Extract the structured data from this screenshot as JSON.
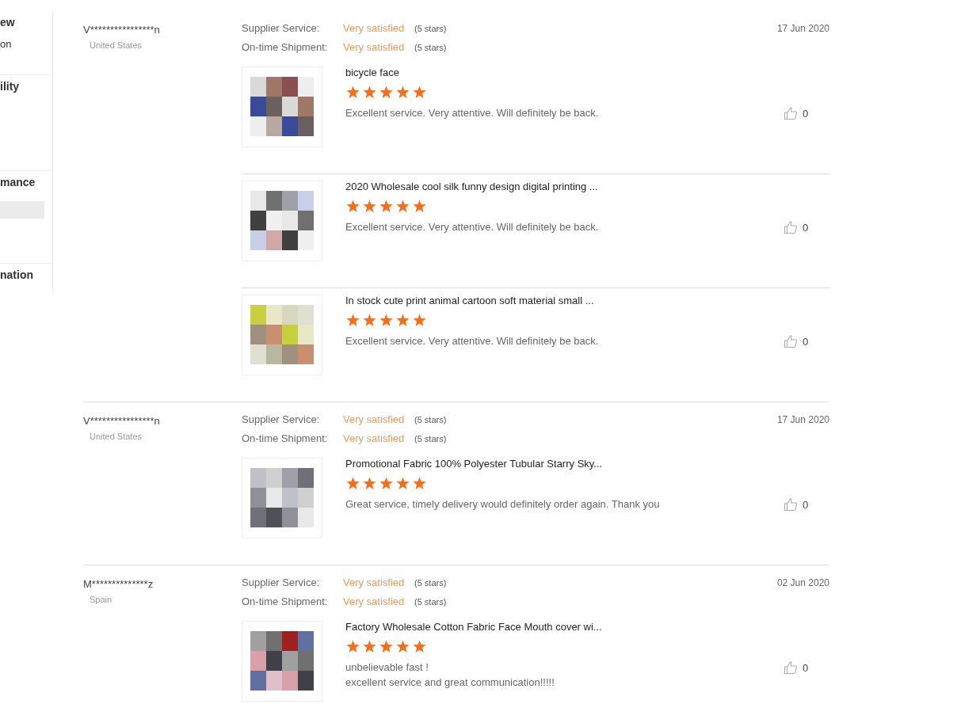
{
  "sidebar": {
    "sections": [
      {
        "title": "ew",
        "items": [
          "on"
        ],
        "highlighted_row": false
      },
      {
        "title": "ility",
        "highlighted_row": false
      },
      {
        "title": "mance",
        "highlighted_row": true
      },
      {
        "title": "nation",
        "highlighted_row": false
      }
    ]
  },
  "reviews": [
    {
      "buyer": "V****************n",
      "country": "United States",
      "date": "17 Jun 2020",
      "ratings": [
        {
          "label": "Supplier Service:",
          "value": "Very satisfied",
          "stars_text": "(5 stars)"
        },
        {
          "label": "On-time Shipment:",
          "value": "Very satisfied",
          "stars_text": "(5 stars)"
        }
      ],
      "products": [
        {
          "title": "bicycle face",
          "stars": 5,
          "comment": "Excellent service.  Very attentive.  Will definitely be back.",
          "likes": "0"
        },
        {
          "title": "2020 Wholesale cool silk funny design digital printing ...",
          "stars": 5,
          "comment": "Excellent service.  Very attentive.  Will definitely be back.",
          "likes": "0"
        },
        {
          "title": "In stock cute print animal cartoon soft material small ...",
          "stars": 5,
          "comment": "Excellent service.  Very attentive.  Will definitely be back.",
          "likes": "0"
        }
      ]
    },
    {
      "buyer": "V****************n",
      "country": "United States",
      "date": "17 Jun 2020",
      "ratings": [
        {
          "label": "Supplier Service:",
          "value": "Very satisfied",
          "stars_text": "(5 stars)"
        },
        {
          "label": "On-time Shipment:",
          "value": "Very satisfied",
          "stars_text": "(5 stars)"
        }
      ],
      "products": [
        {
          "title": "Promotional Fabric 100% Polyester Tubular Starry Sky...",
          "stars": 5,
          "comment": "Great service, timely delivery would definitely order again.  Thank you",
          "likes": "0"
        }
      ]
    },
    {
      "buyer": "M**************z",
      "country": "Spain",
      "date": "02 Jun 2020",
      "ratings": [
        {
          "label": "Supplier Service:",
          "value": "Very satisfied",
          "stars_text": "(5 stars)"
        },
        {
          "label": "On-time Shipment:",
          "value": "Very satisfied",
          "stars_text": "(5 stars)"
        }
      ],
      "products": [
        {
          "title": "Factory Wholesale Cotton Fabric Face Mouth cover wi...",
          "stars": 5,
          "comment": "unbelievable fast !\nexcellent service and great communication!!!!!",
          "likes": "0"
        }
      ]
    }
  ]
}
